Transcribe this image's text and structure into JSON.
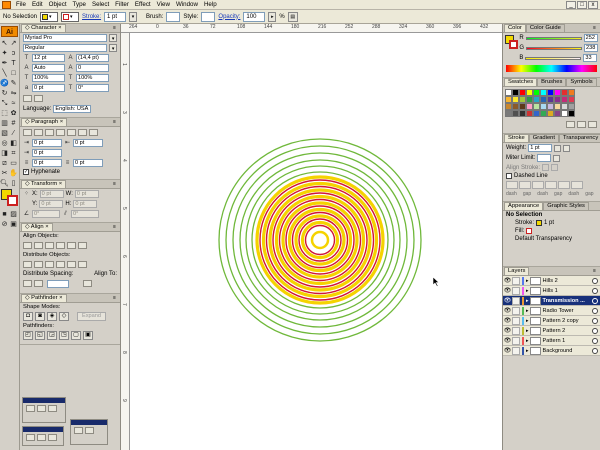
{
  "menubar": {
    "items": [
      "File",
      "Edit",
      "Object",
      "Type",
      "Select",
      "Filter",
      "Effect",
      "View",
      "Window",
      "Help"
    ],
    "window_controls": [
      "_",
      "□",
      "x"
    ]
  },
  "controlbar": {
    "selection_label": "No Selection",
    "stroke_label": "Stroke:",
    "stroke_value": "1 pt",
    "brush_label": "Brush:",
    "style_label": "Style:",
    "opacity_label": "Opacity:",
    "opacity_value": "100",
    "percent": "%"
  },
  "tools": {
    "badge": "Ai"
  },
  "character": {
    "tab": "Character",
    "font": "Myriad Pro",
    "style": "Regular",
    "size": "12 pt",
    "leading": "(14,4 pt)",
    "kerning": "Auto",
    "tracking": "0",
    "hscale": "100%",
    "vscale": "100%",
    "baseline": "0 pt",
    "rotate": "0°",
    "language_label": "Language:",
    "language": "English: USA"
  },
  "paragraph": {
    "tab": "Paragraph",
    "left_indent": "0 pt",
    "right_indent": "0 pt",
    "first_indent": "0 pt",
    "space_before": "0 pt",
    "space_after": "0 pt",
    "hyphenate": "Hyphenate"
  },
  "transform": {
    "tab": "Transform",
    "x_label": "X:",
    "x": "0 pt",
    "y_label": "Y:",
    "y": "0 pt",
    "w_label": "W:",
    "w": "0 pt",
    "h_label": "H:",
    "h": "0 pt",
    "angle": "0°",
    "shear": "0°"
  },
  "align": {
    "tab": "Align",
    "align_objects": "Align Objects:",
    "distribute_objects": "Distribute Objects:",
    "distribute_spacing": "Distribute Spacing:",
    "align_to": "Align To:"
  },
  "pathfinder": {
    "tab": "Pathfinder",
    "shape_modes": "Shape Modes:",
    "expand": "Expand",
    "pathfinders": "Pathfinders:"
  },
  "ruler": {
    "top": [
      "264",
      "0",
      "36",
      "72",
      "108",
      "144",
      "180",
      "216",
      "252",
      "288",
      "324",
      "360",
      "396",
      "432"
    ],
    "left": [
      "1",
      "3",
      "4",
      "5",
      "6",
      "7",
      "8",
      "9"
    ]
  },
  "color_panel": {
    "tabs": [
      "Color",
      "Color Guide"
    ],
    "r_label": "R",
    "r": "252",
    "g_label": "G",
    "g": "238",
    "b_label": "B",
    "b": "33"
  },
  "swatches_panel": {
    "tabs": [
      "Swatches",
      "Brushes",
      "Symbols"
    ],
    "colors": [
      "#ffffff",
      "#000000",
      "#ff0000",
      "#ffff00",
      "#00ff00",
      "#00ffff",
      "#0000ff",
      "#ff00ff",
      "#e42e2e",
      "#f07a1e",
      "#f8b530",
      "#fbe82e",
      "#a3c83a",
      "#2e9a47",
      "#27a5c6",
      "#2864b2",
      "#5c3592",
      "#8a2f8e",
      "#c42a7a",
      "#e03a52",
      "#c8862e",
      "#8a5a2a",
      "#5e3a1a",
      "#ff9cc4",
      "#b8e2a0",
      "#a8d8f0",
      "#c8b8e0",
      "#f8d8a0",
      "#d8d8d8",
      "#a0a0a0",
      "#7a7a7a",
      "#505050",
      "#303030",
      "#cc3333",
      "#3366cc",
      "#33aa55",
      "#ddaa22",
      "#884488",
      "#ffffff",
      "#000000"
    ]
  },
  "stroke_panel": {
    "tabs": [
      "Stroke",
      "Gradient",
      "Transparency"
    ],
    "weight_label": "Weight:",
    "weight": "1 pt",
    "miter_label": "Miter Limit:",
    "align_stroke": "Align Stroke:",
    "dashed_line": "Dashed Line",
    "dash_labels": [
      "dash",
      "gap",
      "dash",
      "gap",
      "dash",
      "gap"
    ]
  },
  "appearance_panel": {
    "tabs": [
      "Appearance",
      "Graphic Styles"
    ],
    "selection": "No Selection",
    "stroke_label": "Stroke:",
    "stroke_value": "1 pt",
    "fill_label": "Fill:",
    "transparency": "Default Transparency"
  },
  "layers_panel": {
    "tab": "Layers",
    "layers": [
      {
        "name": "Hills 2",
        "color": "#5577ee",
        "selected": false
      },
      {
        "name": "Hills 1",
        "color": "#ee55ee",
        "selected": false
      },
      {
        "name": "Transmission ...",
        "color": "#ee9933",
        "selected": true
      },
      {
        "name": "Radio Tower",
        "color": "#55bb55",
        "selected": false
      },
      {
        "name": "Pattern 2 copy",
        "color": "#55bbee",
        "selected": false
      },
      {
        "name": "Pattern 2",
        "color": "#bbbb33",
        "selected": false
      },
      {
        "name": "Pattern 1",
        "color": "#ee5555",
        "selected": false
      },
      {
        "name": "Background",
        "color": "#3355aa",
        "selected": false
      }
    ]
  },
  "artwork": {
    "description_colors": {
      "green": "#6fb83a",
      "yellow": "#f5d300",
      "red": "#d0153a",
      "orange": "#f3a21e"
    }
  }
}
